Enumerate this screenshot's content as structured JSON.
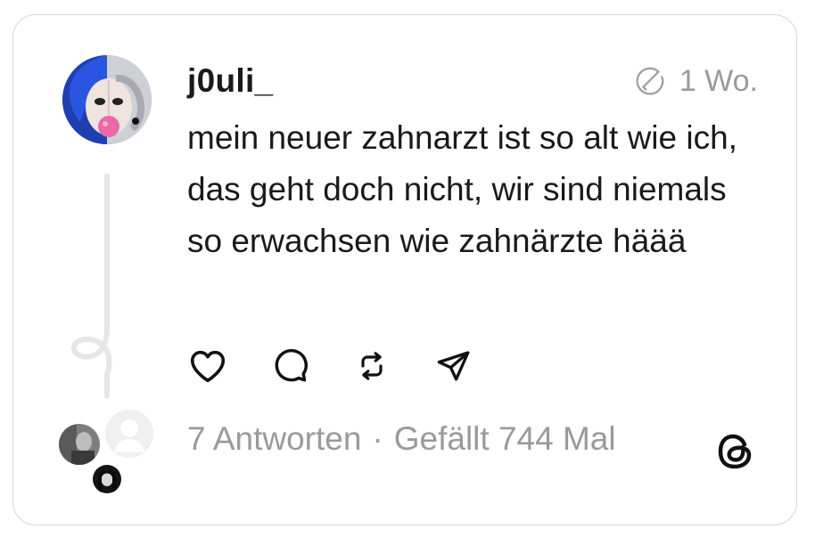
{
  "post": {
    "username": "j0uli_",
    "time": "1 Wo.",
    "text": "mein neuer zahnarzt ist so alt wie ich, das geht doch nicht, wir sind niemals so erwachsen wie zahnärzte häää"
  },
  "stats": {
    "replies": "7 Antworten",
    "separator": "·",
    "likes": "Gefällt 744 Mal"
  },
  "icons": {
    "edited": "edit-circle-icon",
    "like": "heart-icon",
    "reply": "speech-bubble-icon",
    "repost": "repost-icon",
    "share": "send-icon",
    "brand": "threads-logo-icon"
  },
  "colors": {
    "text": "#1a1a1a",
    "muted": "#9a9a9a",
    "border": "#d6d6d6",
    "thread_line": "#e6e6e6"
  }
}
